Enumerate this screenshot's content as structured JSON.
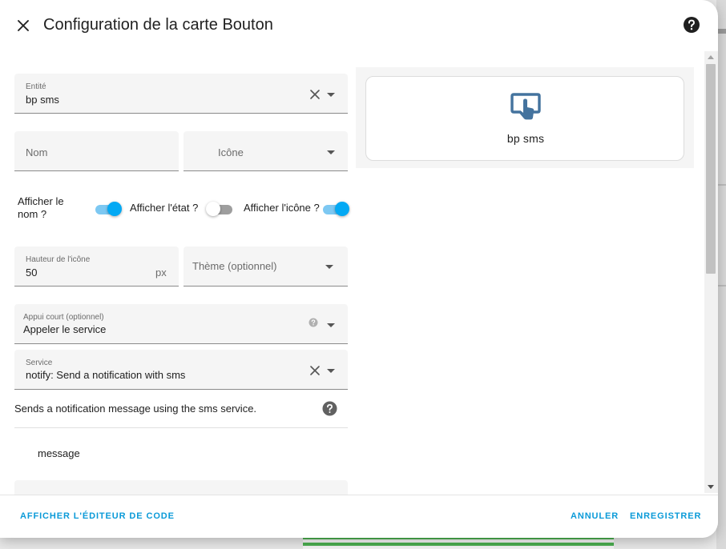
{
  "dialog": {
    "title": "Configuration de la carte Bouton"
  },
  "form": {
    "entity": {
      "label": "Entité",
      "value": "bp sms"
    },
    "name": {
      "placeholder": "Nom"
    },
    "icon": {
      "placeholder": "Icône"
    },
    "toggles": [
      {
        "label": "Afficher le nom ?",
        "on": true
      },
      {
        "label": "Afficher l'état ?",
        "on": false
      },
      {
        "label": "Afficher l'icône ?",
        "on": true
      }
    ],
    "icon_height": {
      "label": "Hauteur de l'icône",
      "value": "50",
      "suffix": "px"
    },
    "theme": {
      "placeholder": "Thème (optionnel)"
    },
    "tap_action": {
      "label": "Appui court (optionnel)",
      "value": "Appeler le service"
    },
    "service": {
      "label": "Service",
      "value": "notify: Send a notification with sms"
    },
    "service_description": "Sends a notification message using the sms service.",
    "param_label": "message"
  },
  "preview": {
    "name": "bp sms",
    "icon": "gesture-tap-button-icon",
    "icon_color": "#44739e"
  },
  "footer": {
    "code_editor": "AFFICHER L'ÉDITEUR DE CODE",
    "cancel": "ANNULER",
    "save": "ENREGISTRER"
  },
  "colors": {
    "accent": "#03a9f4",
    "button_text": "#0a9ad8"
  }
}
